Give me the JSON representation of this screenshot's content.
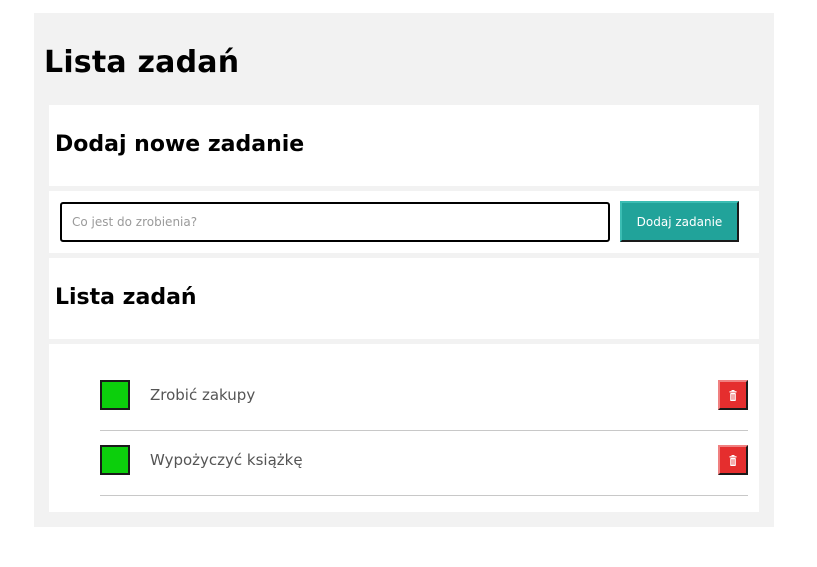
{
  "app": {
    "title": "Lista zadań"
  },
  "add_section": {
    "heading": "Dodaj nowe zadanie",
    "input_value": "",
    "input_placeholder": "Co jest do zrobienia?",
    "button_label": "Dodaj zadanie"
  },
  "list_section": {
    "heading": "Lista zadań",
    "tasks": [
      {
        "label": "Zrobić zakupy",
        "checkbox_color": "#0ccf0c",
        "delete_icon": "trash-icon"
      },
      {
        "label": "Wypożyczyć książkę",
        "checkbox_color": "#0ccf0c",
        "delete_icon": "trash-icon"
      }
    ]
  },
  "colors": {
    "accent": "#21a39a",
    "done": "#0ccf0c",
    "danger": "#e52e2e",
    "background": "#f2f2f2"
  }
}
